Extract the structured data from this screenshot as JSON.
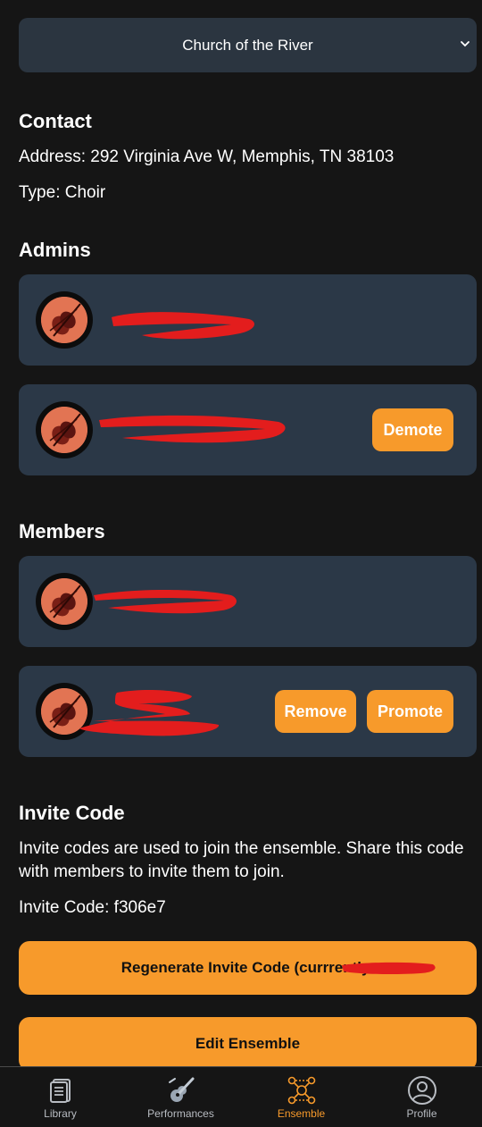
{
  "ensemble_selector": {
    "selected": "Church of the River"
  },
  "contact": {
    "heading": "Contact",
    "address_line": "Address: 292 Virginia Ave W, Memphis, TN 38103",
    "type_line": "Type: Choir"
  },
  "admins": {
    "heading": "Admins",
    "items": [
      {
        "name": "",
        "action_label": ""
      },
      {
        "name": "",
        "action_label": "Demote"
      }
    ]
  },
  "members": {
    "heading": "Members",
    "items": [
      {
        "name": "",
        "actions": []
      },
      {
        "name": "",
        "actions": [
          "Remove",
          "Promote"
        ]
      }
    ]
  },
  "invite": {
    "heading": "Invite Code",
    "description": "Invite codes are used to join the ensemble. Share this code with members to invite them to join.",
    "code_line": "Invite Code: f306e7",
    "regenerate_label": "Regenerate Invite Code (currrently ",
    "edit_label": "Edit Ensemble"
  },
  "nav": {
    "items": [
      {
        "label": "Library",
        "icon": "library-icon",
        "active": false
      },
      {
        "label": "Performances",
        "icon": "guitar-icon",
        "active": false
      },
      {
        "label": "Ensemble",
        "icon": "ensemble-network-icon",
        "active": true
      },
      {
        "label": "Profile",
        "icon": "user-circle-icon",
        "active": false
      }
    ]
  },
  "colors": {
    "accent": "#f79a2b",
    "card": "#2b3847",
    "background": "#151515",
    "redaction": "#e31d1d"
  }
}
